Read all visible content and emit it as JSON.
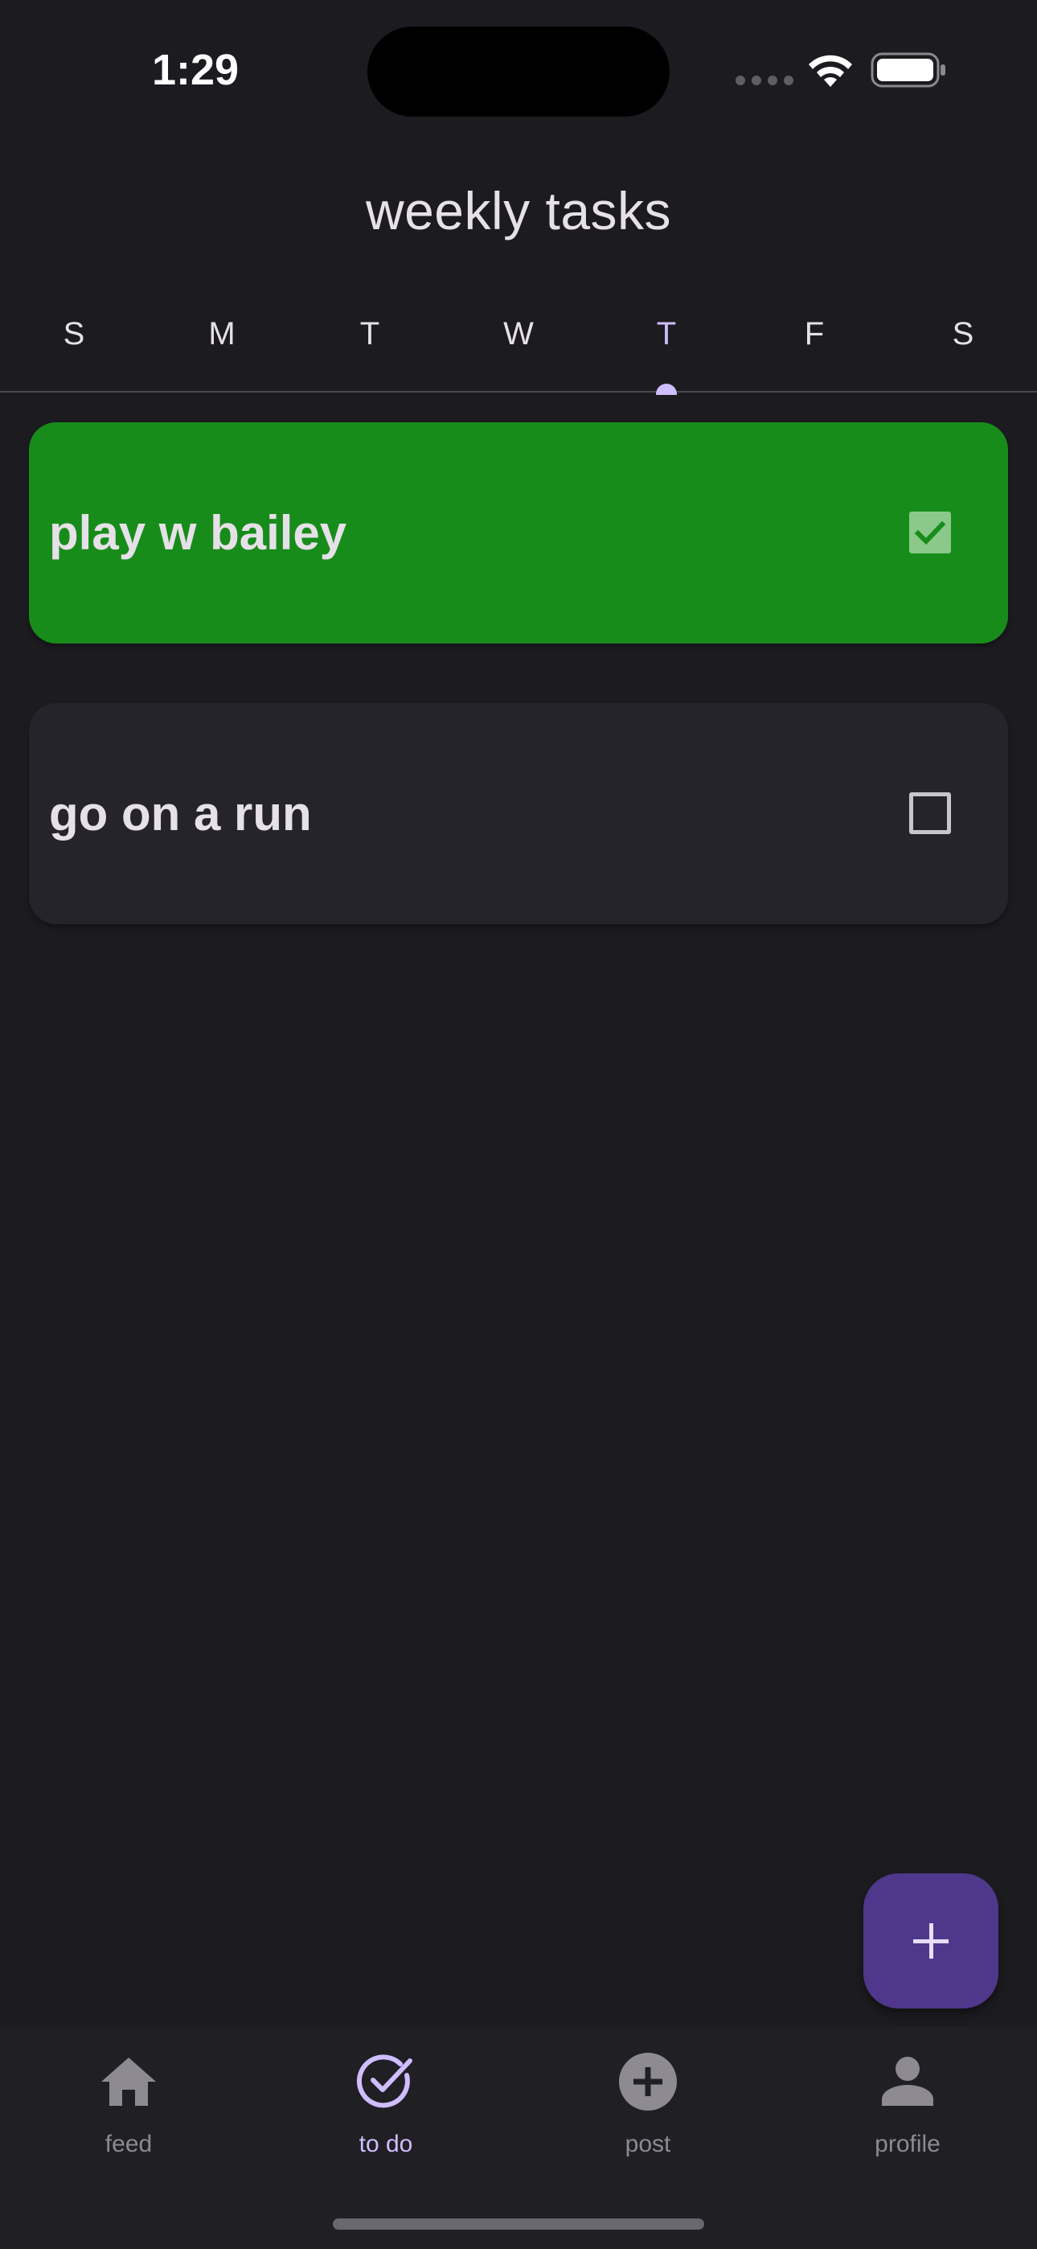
{
  "status_bar": {
    "time": "1:29"
  },
  "header": {
    "title": "weekly tasks"
  },
  "days": {
    "items": [
      "S",
      "M",
      "T",
      "W",
      "T",
      "F",
      "S"
    ],
    "selected_index": 4
  },
  "tasks": [
    {
      "label": "play w bailey",
      "completed": true
    },
    {
      "label": "go on a run",
      "completed": false
    }
  ],
  "fab": {
    "icon": "plus-icon"
  },
  "bottom_nav": {
    "items": [
      {
        "label": "feed",
        "icon": "home-icon",
        "active": false
      },
      {
        "label": "to do",
        "icon": "check-circle-icon",
        "active": true
      },
      {
        "label": "post",
        "icon": "add-circle-icon",
        "active": false
      },
      {
        "label": "profile",
        "icon": "person-icon",
        "active": false
      }
    ]
  },
  "colors": {
    "background": "#1c1b20",
    "accent": "#cfbdfe",
    "completed_card": "#188c1b",
    "todo_card": "#25242a",
    "fab": "#4f378b",
    "inactive_nav": "#8d8a92"
  }
}
